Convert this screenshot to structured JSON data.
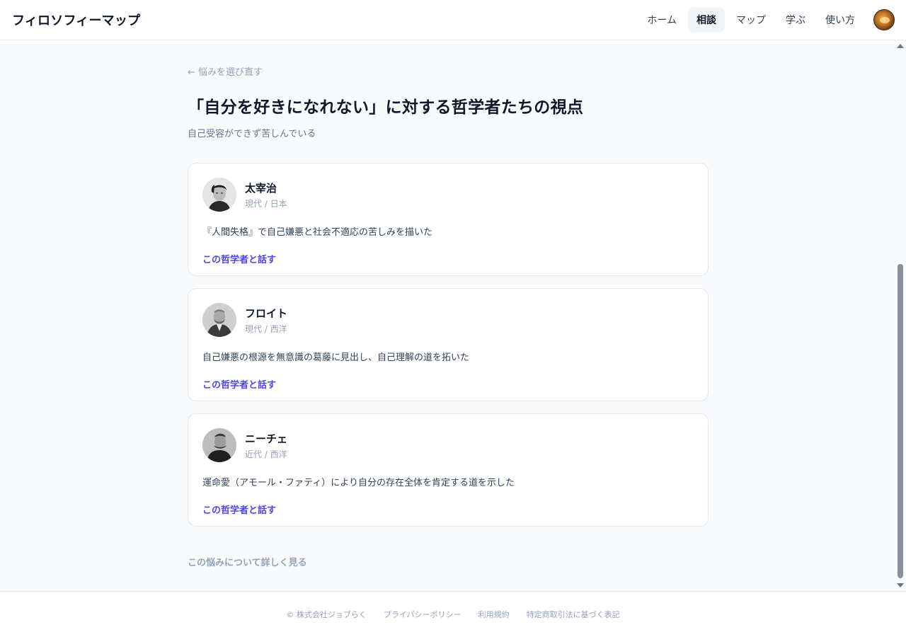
{
  "header": {
    "brand": "フィロソフィーマップ",
    "nav": [
      {
        "label": "ホーム"
      },
      {
        "label": "相談"
      },
      {
        "label": "マップ"
      },
      {
        "label": "学ぶ"
      },
      {
        "label": "使い方"
      }
    ],
    "active_nav": "相談"
  },
  "main": {
    "back_link": "← 悩みを選び直す",
    "title": "「自分を好きになれない」に対する哲学者たちの視点",
    "subtitle": "自己受容ができず苦しんでいる",
    "cards": [
      {
        "name": "太宰治",
        "era": "現代 / 日本",
        "description": "『人間失格』で自己嫌悪と社会不適応の苦しみを描いた",
        "link": "この哲学者と話す"
      },
      {
        "name": "フロイト",
        "era": "現代 / 西洋",
        "description": "自己嫌悪の根源を無意識の葛藤に見出し、自己理解の道を拓いた",
        "link": "この哲学者と話す"
      },
      {
        "name": "ニーチェ",
        "era": "近代 / 西洋",
        "description": "運命愛（アモール・ファティ）により自分の存在全体を肯定する道を示した",
        "link": "この哲学者と話す"
      }
    ],
    "more_link": "この悩みについて詳しく見る"
  },
  "footer": {
    "copyright": "© 株式会社ジョブらく",
    "links": [
      "プライバシーポリシー",
      "利用規約",
      "特定商取引法に基づく表記"
    ]
  },
  "colors": {
    "accent": "#4f46e5",
    "background": "#f8fafc",
    "card_border": "#e2e8f0"
  }
}
